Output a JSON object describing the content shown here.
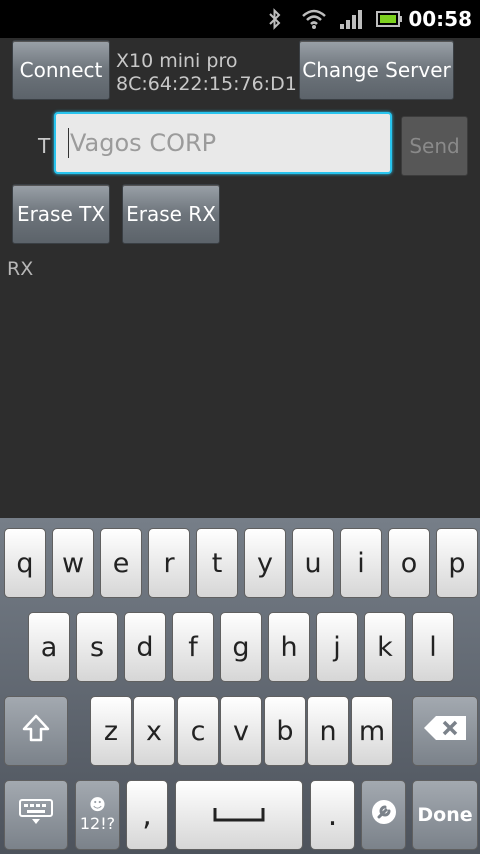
{
  "status_bar": {
    "time": "00:58",
    "icons": [
      "bluetooth-icon",
      "wifi-icon",
      "signal-icon",
      "battery-icon"
    ]
  },
  "toolbar": {
    "connect_label": "Connect",
    "device_name": "X10 mini pro",
    "device_address": "8C:64:22:15:76:D1",
    "change_server_label": "Change Server"
  },
  "tx": {
    "label": "T",
    "input_placeholder": "Vagos CORP",
    "send_label": "Send"
  },
  "erase": {
    "erase_tx_label": "Erase TX",
    "erase_rx_label": "Erase RX"
  },
  "rx": {
    "label": "RX"
  },
  "keyboard": {
    "row1": [
      "q",
      "w",
      "e",
      "r",
      "t",
      "y",
      "u",
      "i",
      "o",
      "p"
    ],
    "row2": [
      "a",
      "s",
      "d",
      "f",
      "g",
      "h",
      "j",
      "k",
      "l"
    ],
    "row3": [
      "z",
      "x",
      "c",
      "v",
      "b",
      "n",
      "m"
    ],
    "symbols_label": "12!?",
    "comma": ",",
    "period": ".",
    "done_label": "Done",
    "colors": {
      "accent": "#28c4ee",
      "background": "#2d2d2d"
    }
  }
}
